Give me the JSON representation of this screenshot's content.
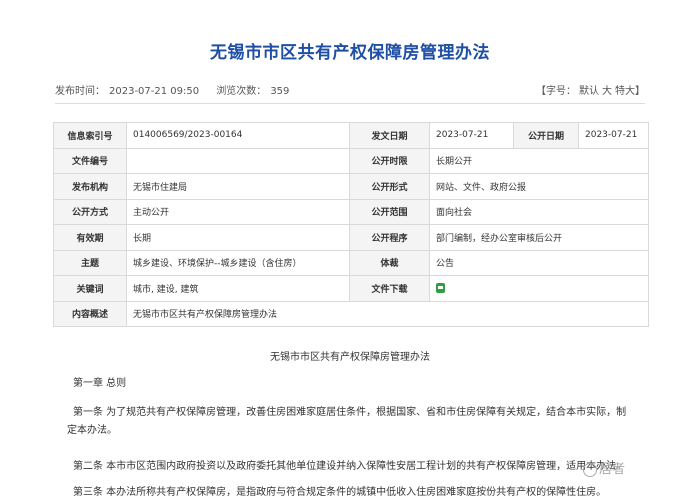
{
  "page": {
    "title": "无锡市市区共有产权保障房管理办法"
  },
  "meta": {
    "publish_time_label": "发布时间：",
    "publish_time": "2023-07-21 09:50",
    "views_label": "浏览次数：",
    "views": "359",
    "font_size_prefix": "【字号：",
    "font_default": "默认",
    "font_large": "大",
    "font_xlarge": "特大",
    "font_size_suffix": "】"
  },
  "info_table": {
    "rows": [
      {
        "l1": "信息索引号",
        "v1": "014006569/2023-00164",
        "l2": "发文日期",
        "v2": "2023-07-21",
        "l3": "公开日期",
        "v3": "2023-07-21"
      },
      {
        "l1": "文件编号",
        "v1": "",
        "l2": "公开时限",
        "v2": "长期公开"
      },
      {
        "l1": "发布机构",
        "v1": "无锡市住建局",
        "l2": "公开形式",
        "v2": "网站、文件、政府公报"
      },
      {
        "l1": "公开方式",
        "v1": "主动公开",
        "l2": "公开范围",
        "v2": "面向社会"
      },
      {
        "l1": "有效期",
        "v1": "长期",
        "l2": "公开程序",
        "v2": "部门编制，经办公室审核后公开"
      },
      {
        "l1": "主题",
        "v1": "城乡建设、环境保护--城乡建设（含住房）",
        "l2": "体裁",
        "v2": "公告"
      },
      {
        "l1": "关键词",
        "v1": "城市, 建设, 建筑",
        "l2": "文件下载",
        "v2_icon": "download-file-icon"
      },
      {
        "l1": "内容概述",
        "v1": "无锡市市区共有产权保障房管理办法"
      }
    ]
  },
  "document": {
    "heading": "无锡市市区共有产权保障房管理办法",
    "chapter1": "第一章 总则",
    "article1_line1": "第一条 为了规范共有产权保障房管理，改善住房困难家庭居住条件，根据国家、省和市住房保障有关规定，结合本市实际，制",
    "article1_line2": "定本办法。",
    "article2": "第二条 本市市区范围内政府投资以及政府委托其他单位建设并纳入保障性安居工程计划的共有产权保障房管理，适用本办法。",
    "article3": "第三条 本办法所称共有产权保障房，是指政府与符合规定条件的城镇中低收入住房困难家庭按份共有产权的保障性住房。"
  },
  "watermark": {
    "text": "居者"
  }
}
